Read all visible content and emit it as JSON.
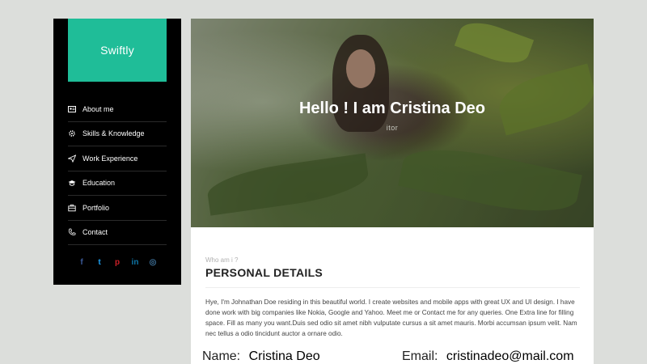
{
  "sidebar": {
    "logo": "Swiftly",
    "items": [
      {
        "label": "About me",
        "icon": "profile-card-icon"
      },
      {
        "label": "Skills & Knowledge",
        "icon": "gear-icon"
      },
      {
        "label": "Work Experience",
        "icon": "paper-plane-icon"
      },
      {
        "label": "Education",
        "icon": "graduation-cap-icon"
      },
      {
        "label": "Portfolio",
        "icon": "briefcase-icon"
      },
      {
        "label": "Contact",
        "icon": "phone-icon"
      }
    ],
    "social": [
      {
        "icon": "facebook-icon",
        "glyph": "f",
        "color": "#3b5998"
      },
      {
        "icon": "twitter-icon",
        "glyph": "t",
        "color": "#1da1f2"
      },
      {
        "icon": "pinterest-icon",
        "glyph": "p",
        "color": "#cb2027"
      },
      {
        "icon": "linkedin-icon",
        "glyph": "in",
        "color": "#0e76a8"
      },
      {
        "icon": "instagram-icon",
        "glyph": "◎",
        "color": "#3f729b"
      }
    ]
  },
  "hero": {
    "title": "Hello ! I am Cristina Deo",
    "subtitle": "itor"
  },
  "about": {
    "eyebrow": "Who am i ?",
    "heading": "PERSONAL DETAILS",
    "bio": "Hye, I'm Johnathan Doe residing in this beautiful world. I create websites and mobile apps with great UX and UI design. I have done work with big companies like Nokia, Google and Yahoo. Meet me or Contact me for any queries. One Extra line for filling space. Fill as many you want.Duis sed odio sit amet nibh vulputate cursus a sit amet mauris. Morbi accumsan ipsum velit. Nam nec tellus a odio tincidunt auctor a ornare odio."
  },
  "details": {
    "name_label": "Name:",
    "name_value": "Cristina Deo",
    "email_label": "Email:",
    "email_value": "cristinadeo@mail.com"
  },
  "colors": {
    "accent": "#1fbd98",
    "sidebar_bg": "#000000",
    "page_bg": "#dcdedb"
  }
}
